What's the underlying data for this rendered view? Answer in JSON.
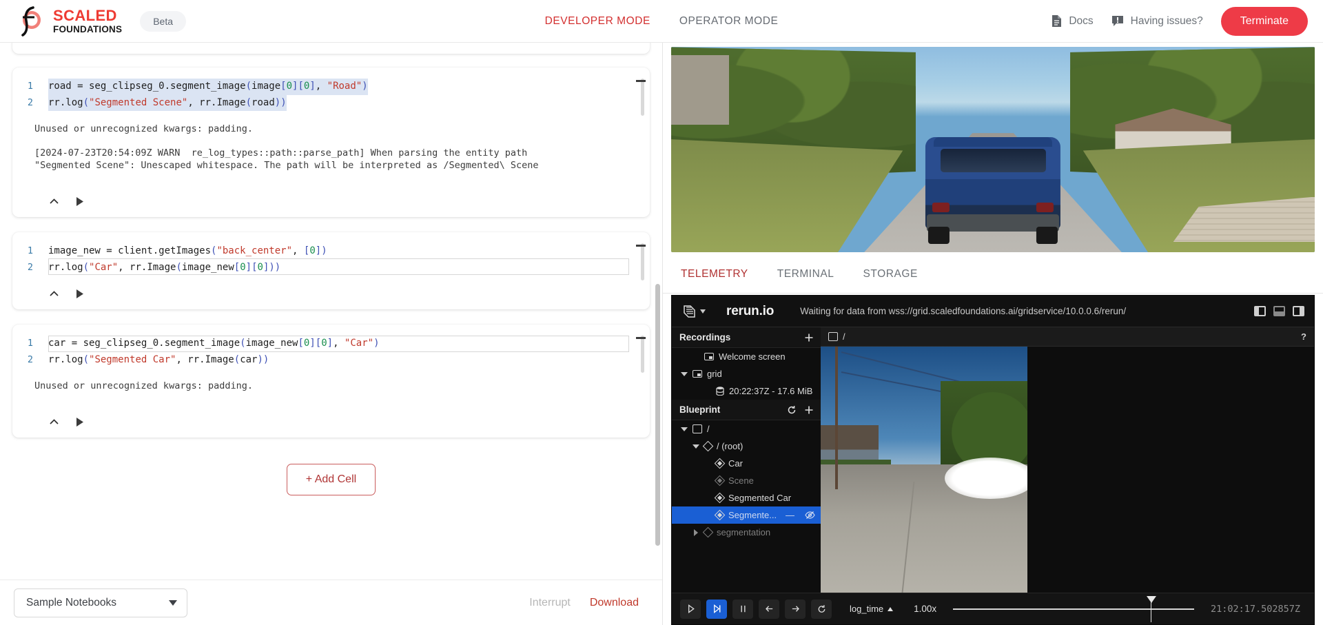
{
  "header": {
    "brand_top": "SCALED",
    "brand_bottom": "FOUNDATIONS",
    "beta_label": "Beta",
    "modes": [
      {
        "label": "DEVELOPER MODE",
        "active": true
      },
      {
        "label": "OPERATOR MODE",
        "active": false
      }
    ],
    "docs_label": "Docs",
    "docs_icon": "document-icon",
    "issues_label": "Having issues?",
    "issues_icon": "chat-alert-icon",
    "terminate_label": "Terminate",
    "accent_red": "#ee3b47",
    "brand_red": "#ee3b33"
  },
  "notebook": {
    "cells": [
      {
        "lines": [
          {
            "num": "1",
            "segments": [
              {
                "t": "road = seg_clipseg_0.segment_image",
                "c": "plain"
              },
              {
                "t": "(",
                "c": "punc"
              },
              {
                "t": "image",
                "c": "plain"
              },
              {
                "t": "[",
                "c": "punc"
              },
              {
                "t": "0",
                "c": "num"
              },
              {
                "t": "][",
                "c": "punc"
              },
              {
                "t": "0",
                "c": "num"
              },
              {
                "t": "]",
                "c": "punc"
              },
              {
                "t": ", ",
                "c": "plain"
              },
              {
                "t": "\"Road\"",
                "c": "str"
              },
              {
                "t": ")",
                "c": "punc"
              }
            ]
          },
          {
            "num": "2",
            "segments": [
              {
                "t": "rr.log",
                "c": "plain"
              },
              {
                "t": "(",
                "c": "punc"
              },
              {
                "t": "\"Segmented Scene\"",
                "c": "str"
              },
              {
                "t": ", rr.Image",
                "c": "plain"
              },
              {
                "t": "(",
                "c": "punc"
              },
              {
                "t": "road",
                "c": "plain"
              },
              {
                "t": "))",
                "c": "punc"
              }
            ]
          }
        ],
        "outputs": [
          "Unused or unrecognized kwargs: padding.",
          "[2024-07-23T20:54:09Z WARN  re_log_types::path::parse_path] When parsing the entity path\n\"Segmented Scene\": Unescaped whitespace. The path will be interpreted as /Segmented\\ Scene"
        ]
      },
      {
        "lines": [
          {
            "num": "1",
            "segments": [
              {
                "t": "image_new = client.getImages",
                "c": "plain"
              },
              {
                "t": "(",
                "c": "punc"
              },
              {
                "t": "\"back_center\"",
                "c": "str"
              },
              {
                "t": ", ",
                "c": "plain"
              },
              {
                "t": "[",
                "c": "punc"
              },
              {
                "t": "0",
                "c": "num"
              },
              {
                "t": "])",
                "c": "punc"
              }
            ]
          },
          {
            "num": "2",
            "segments": [
              {
                "t": "rr.log",
                "c": "plain"
              },
              {
                "t": "(",
                "c": "punc"
              },
              {
                "t": "\"Car\"",
                "c": "str"
              },
              {
                "t": ", rr.Image",
                "c": "plain"
              },
              {
                "t": "(",
                "c": "punc"
              },
              {
                "t": "image_new",
                "c": "plain"
              },
              {
                "t": "[",
                "c": "punc"
              },
              {
                "t": "0",
                "c": "num"
              },
              {
                "t": "][",
                "c": "punc"
              },
              {
                "t": "0",
                "c": "num"
              },
              {
                "t": "]))",
                "c": "punc"
              }
            ]
          }
        ],
        "outputs": []
      },
      {
        "lines": [
          {
            "num": "1",
            "segments": [
              {
                "t": "car = seg_clipseg_0.segment_image",
                "c": "plain"
              },
              {
                "t": "(",
                "c": "punc"
              },
              {
                "t": "image_new",
                "c": "plain"
              },
              {
                "t": "[",
                "c": "punc"
              },
              {
                "t": "0",
                "c": "num"
              },
              {
                "t": "][",
                "c": "punc"
              },
              {
                "t": "0",
                "c": "num"
              },
              {
                "t": "]",
                "c": "punc"
              },
              {
                "t": ", ",
                "c": "plain"
              },
              {
                "t": "\"Car\"",
                "c": "str"
              },
              {
                "t": ")",
                "c": "punc"
              }
            ]
          },
          {
            "num": "2",
            "segments": [
              {
                "t": "rr.log",
                "c": "plain"
              },
              {
                "t": "(",
                "c": "punc"
              },
              {
                "t": "\"Segmented Car\"",
                "c": "str"
              },
              {
                "t": ", rr.Image",
                "c": "plain"
              },
              {
                "t": "(",
                "c": "punc"
              },
              {
                "t": "car",
                "c": "plain"
              },
              {
                "t": "))",
                "c": "punc"
              }
            ]
          }
        ],
        "outputs": [
          "Unused or unrecognized kwargs: padding."
        ]
      }
    ],
    "add_cell_label": "+ Add Cell",
    "sample_notebooks_label": "Sample Notebooks",
    "interrupt_label": "Interrupt",
    "download_label": "Download"
  },
  "right_panel": {
    "tabs": [
      {
        "label": "TELEMETRY",
        "active": true
      },
      {
        "label": "TERMINAL",
        "active": false
      },
      {
        "label": "STORAGE",
        "active": false
      }
    ]
  },
  "rerun": {
    "title": "rerun.io",
    "status": "Waiting for data from wss://grid.scaledfoundations.ai/gridservice/10.0.0.6/rerun/",
    "layout_icons": [
      "panel-left-icon",
      "panel-bottom-icon",
      "panel-right-icon"
    ],
    "recordings": {
      "title": "Recordings",
      "add_icon": "plus-icon",
      "items": [
        {
          "label": "Welcome screen",
          "icon": "recording-icon",
          "indent": 1,
          "expandable": false,
          "dim": false
        },
        {
          "label": "grid",
          "icon": "recording-icon",
          "indent": 0,
          "expandable": true,
          "expanded": true,
          "dim": false
        },
        {
          "label": "20:22:37Z - 17.6 MiB",
          "icon": "database-icon",
          "indent": 2,
          "expandable": false,
          "dim": false
        }
      ]
    },
    "blueprint": {
      "title": "Blueprint",
      "reset_icon": "reset-icon",
      "add_icon": "plus-icon",
      "items": [
        {
          "label": "/",
          "icon": "blueprint-icon",
          "indent": 0,
          "expandable": true,
          "expanded": true,
          "dim": false,
          "selected": false
        },
        {
          "label": "/ (root)",
          "icon": "diamond-outline-icon",
          "indent": 1,
          "expandable": true,
          "expanded": true,
          "dim": false,
          "selected": false
        },
        {
          "label": "Car",
          "icon": "diamond-filled-icon",
          "indent": 2,
          "expandable": false,
          "dim": false,
          "selected": false
        },
        {
          "label": "Scene",
          "icon": "diamond-filled-icon",
          "indent": 2,
          "expandable": false,
          "dim": true,
          "selected": false
        },
        {
          "label": "Segmented Car",
          "icon": "diamond-filled-icon",
          "indent": 2,
          "expandable": false,
          "dim": false,
          "selected": false
        },
        {
          "label": "Segmente...",
          "icon": "diamond-filled-icon",
          "indent": 2,
          "expandable": false,
          "dim": false,
          "selected": true,
          "dash": "—",
          "eye": "eye-off-icon"
        },
        {
          "label": "segmentation",
          "icon": "diamond-outline-icon",
          "indent": 1,
          "expandable": true,
          "expanded": false,
          "dim": true,
          "selected": false
        }
      ]
    },
    "breadcrumb": "/",
    "help_label": "?",
    "controls": {
      "play_icon": "play-icon",
      "step_forward_icon": "step-forward-icon",
      "pause_icon": "pause-icon",
      "back_icon": "arrow-left-icon",
      "forward_icon": "arrow-right-icon",
      "loop_icon": "loop-icon",
      "timeline_label": "log_time",
      "rate_label": "1.00x",
      "time_value": "21:02:17.502857Z"
    }
  }
}
